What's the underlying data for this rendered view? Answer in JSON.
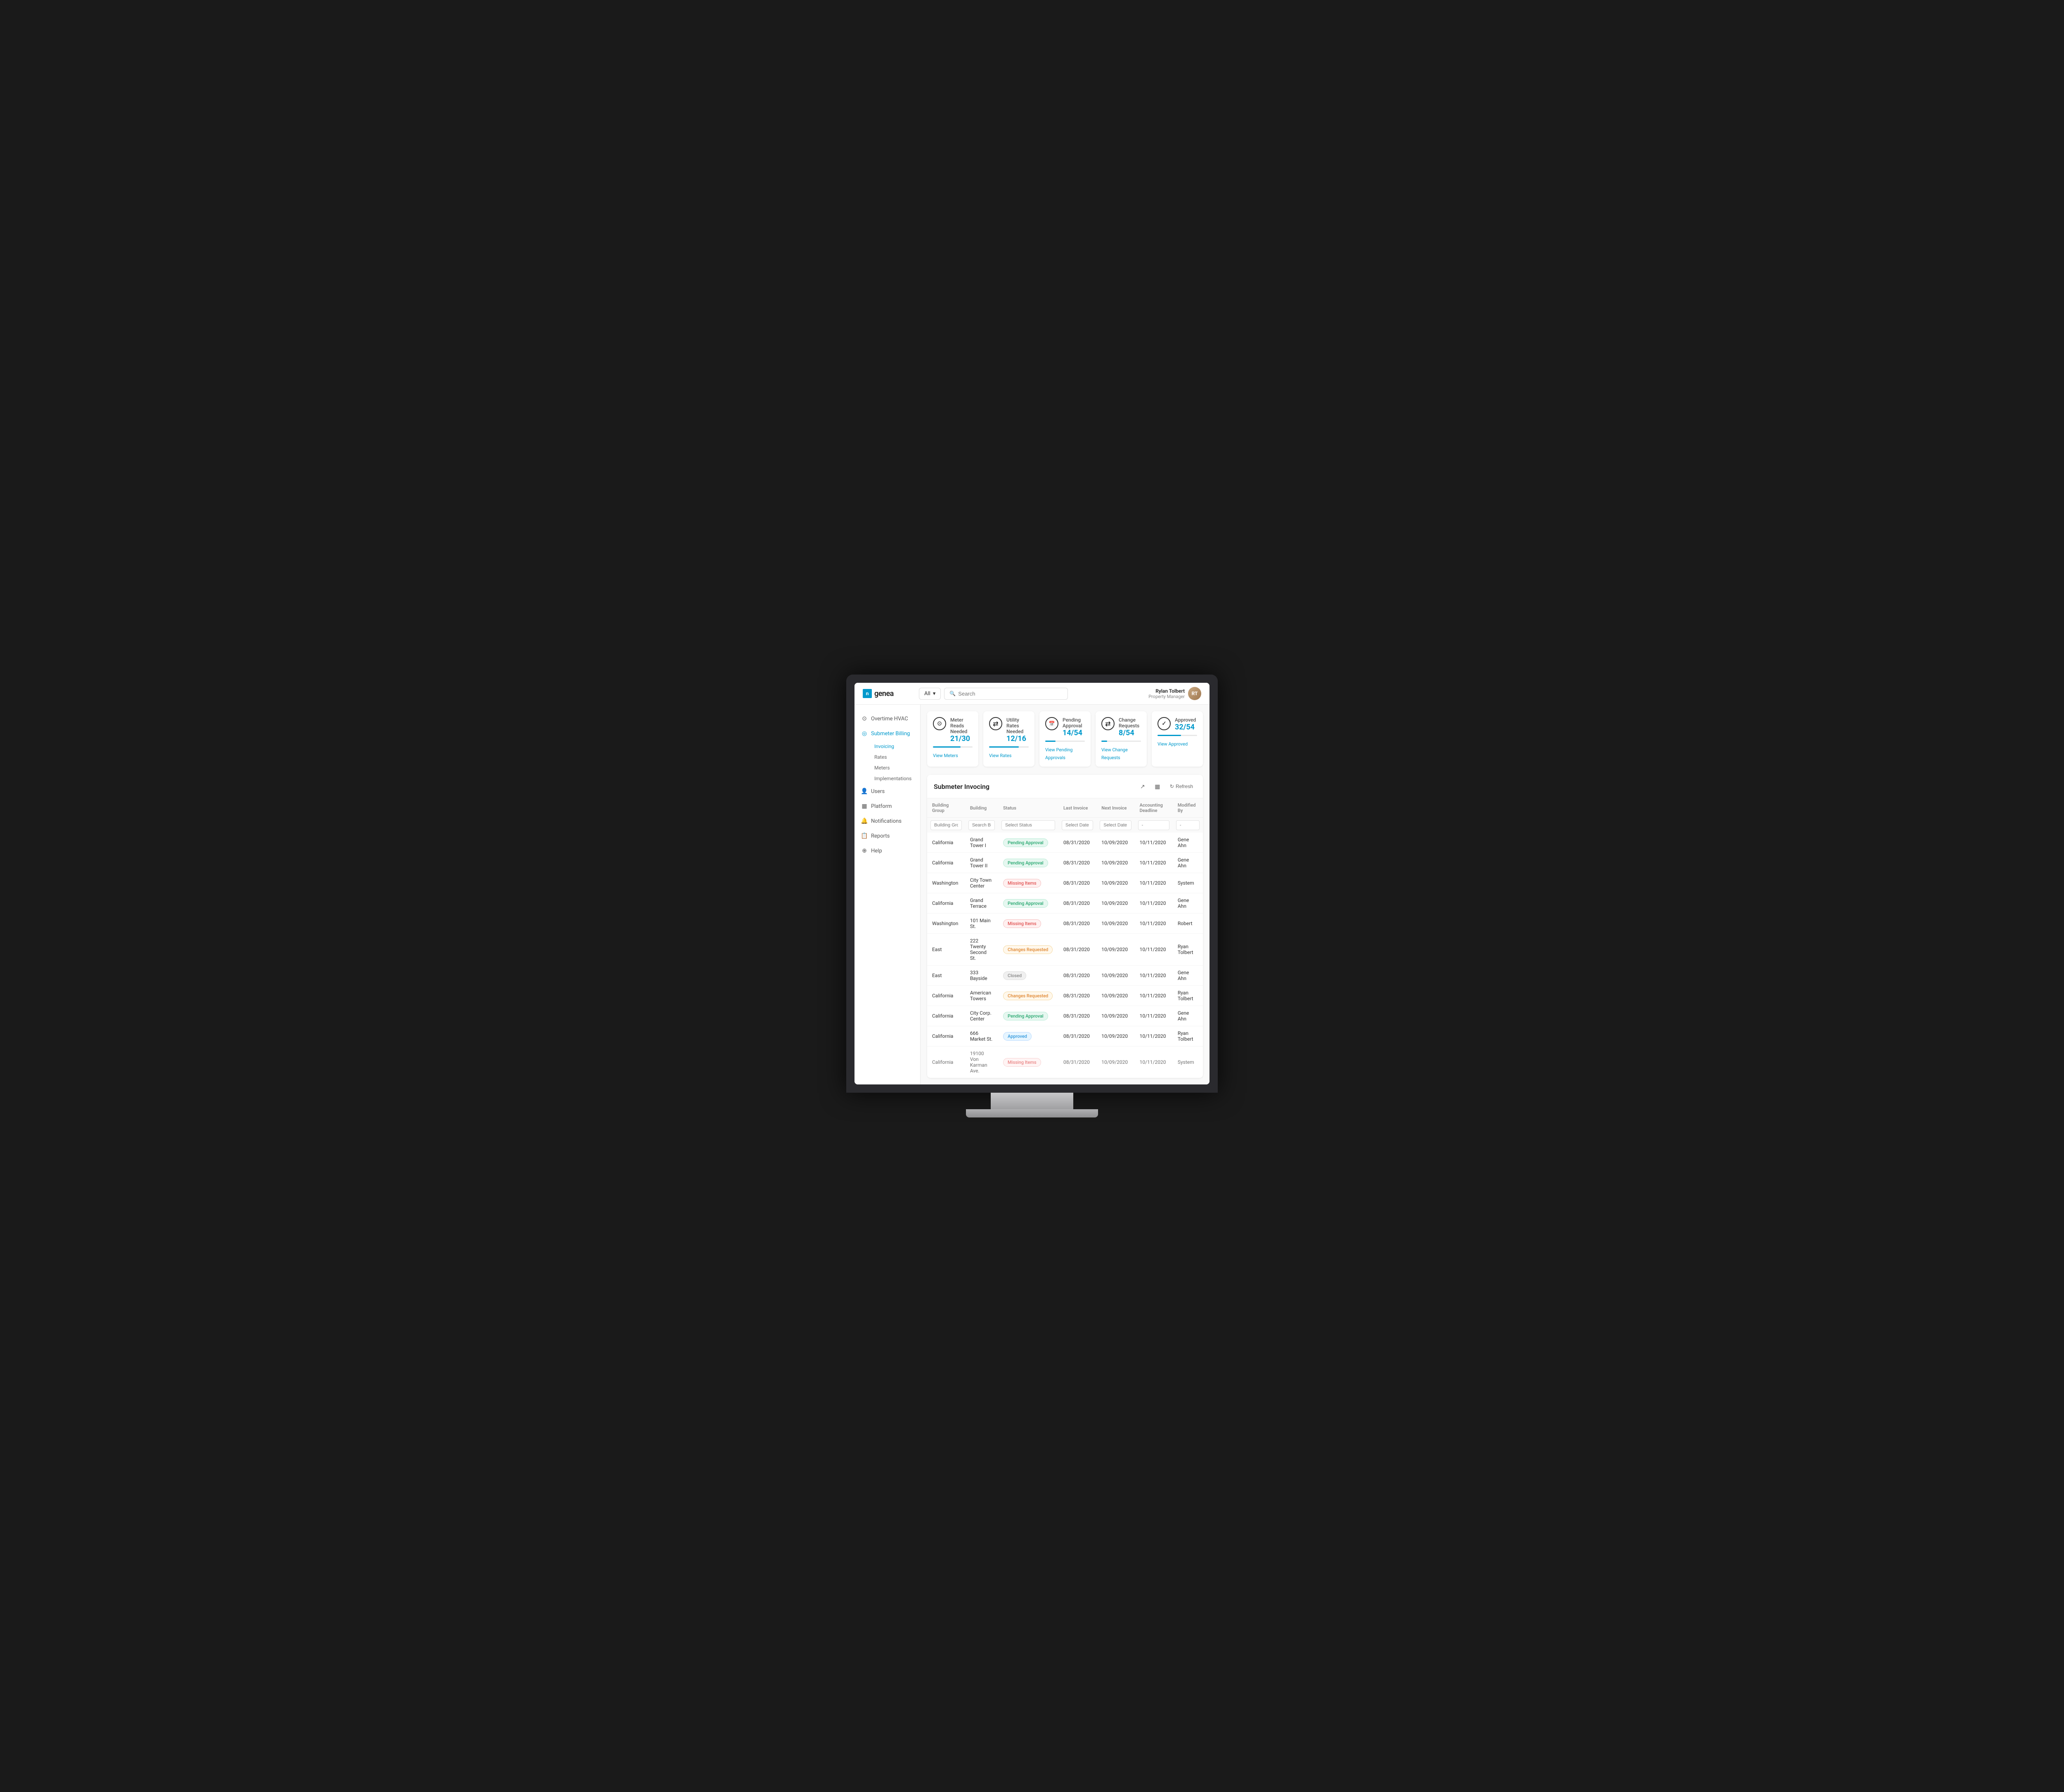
{
  "app": {
    "logo_text": "genea",
    "logo_icon": "n"
  },
  "topbar": {
    "filter_label": "All",
    "search_placeholder": "Search",
    "user": {
      "name": "Rylan Tolbert",
      "role": "Property Manager",
      "initials": "RT"
    }
  },
  "sidebar": {
    "items": [
      {
        "id": "overtime-hvac",
        "label": "Overtime HVAC",
        "icon": "⊙"
      },
      {
        "id": "submeter-billing",
        "label": "Submeter Billing",
        "icon": "◎",
        "active": true
      },
      {
        "id": "users",
        "label": "Users",
        "icon": "👤"
      },
      {
        "id": "platform",
        "label": "Platform",
        "icon": "▦"
      },
      {
        "id": "notifications",
        "label": "Notifications",
        "icon": "🔔"
      },
      {
        "id": "reports",
        "label": "Reports",
        "icon": "📋"
      },
      {
        "id": "help",
        "label": "Help",
        "icon": "⊕"
      }
    ],
    "submenu": [
      {
        "id": "invoicing",
        "label": "Invoicing",
        "active": true
      },
      {
        "id": "rates",
        "label": "Rates"
      },
      {
        "id": "meters",
        "label": "Meters"
      },
      {
        "id": "implementations",
        "label": "Implementations"
      }
    ]
  },
  "stats": [
    {
      "id": "meter-reads",
      "title": "Meter Reads Needed",
      "value": "21/30",
      "progress": 70,
      "link": "View Meters",
      "icon": "⊙"
    },
    {
      "id": "utility-rates",
      "title": "Utility Rates Needed",
      "value": "12/16",
      "progress": 75,
      "link": "View Rates",
      "icon": "⇄"
    },
    {
      "id": "pending-approval",
      "title": "Pending Approval",
      "value": "14/54",
      "progress": 26,
      "link": "View Pending Approvals",
      "icon": "📅"
    },
    {
      "id": "change-requests",
      "title": "Change Requests",
      "value": "8/54",
      "progress": 15,
      "link": "View Change Requests",
      "icon": "⇄"
    },
    {
      "id": "approved",
      "title": "Approved",
      "value": "32/54",
      "progress": 59,
      "link": "View Approved",
      "icon": "✓"
    }
  ],
  "table": {
    "title": "Submeter Invocing",
    "refresh_label": "Refresh",
    "columns": [
      "Building Group",
      "Building",
      "Status",
      "Last Invoice",
      "Next Invoice",
      "Accounting Deadline",
      "Modified By"
    ],
    "filters": [
      {
        "placeholder": "Building Group"
      },
      {
        "placeholder": "Search Building"
      },
      {
        "placeholder": "Select Status"
      },
      {
        "placeholder": "Select Date"
      },
      {
        "placeholder": "Select Date"
      },
      {
        "placeholder": "-"
      },
      {
        "placeholder": "-"
      }
    ],
    "rows": [
      {
        "building_group": "California",
        "building": "Grand Tower I",
        "status": "Pending Approval",
        "status_type": "pending",
        "last_invoice": "08/31/2020",
        "next_invoice": "10/09/2020",
        "accounting_deadline": "10/11/2020",
        "modified_by": "Gene Ahn"
      },
      {
        "building_group": "California",
        "building": "Grand Tower II",
        "status": "Pending Approval",
        "status_type": "pending",
        "last_invoice": "08/31/2020",
        "next_invoice": "10/09/2020",
        "accounting_deadline": "10/11/2020",
        "modified_by": "Gene Ahn"
      },
      {
        "building_group": "Washington",
        "building": "City Town Center",
        "status": "Missing Items",
        "status_type": "missing",
        "last_invoice": "08/31/2020",
        "next_invoice": "10/09/2020",
        "accounting_deadline": "10/11/2020",
        "modified_by": "System"
      },
      {
        "building_group": "California",
        "building": "Grand Terrace",
        "status": "Pending Approval",
        "status_type": "pending",
        "last_invoice": "08/31/2020",
        "next_invoice": "10/09/2020",
        "accounting_deadline": "10/11/2020",
        "modified_by": "Gene Ahn"
      },
      {
        "building_group": "Washington",
        "building": "101 Main St.",
        "status": "Missing Items",
        "status_type": "missing",
        "last_invoice": "08/31/2020",
        "next_invoice": "10/09/2020",
        "accounting_deadline": "10/11/2020",
        "modified_by": "Robert"
      },
      {
        "building_group": "East",
        "building": "222 Twenty Second St.",
        "status": "Changes Requested",
        "status_type": "changes",
        "last_invoice": "08/31/2020",
        "next_invoice": "10/09/2020",
        "accounting_deadline": "10/11/2020",
        "modified_by": "Ryan Tolbert"
      },
      {
        "building_group": "East",
        "building": "333 Bayside",
        "status": "Closed",
        "status_type": "closed",
        "last_invoice": "08/31/2020",
        "next_invoice": "10/09/2020",
        "accounting_deadline": "10/11/2020",
        "modified_by": "Gene Ahn"
      },
      {
        "building_group": "California",
        "building": "American Towers",
        "status": "Changes Requested",
        "status_type": "changes",
        "last_invoice": "08/31/2020",
        "next_invoice": "10/09/2020",
        "accounting_deadline": "10/11/2020",
        "modified_by": "Ryan Tolbert"
      },
      {
        "building_group": "California",
        "building": "City Corp. Center",
        "status": "Pending Approval",
        "status_type": "pending",
        "last_invoice": "08/31/2020",
        "next_invoice": "10/09/2020",
        "accounting_deadline": "10/11/2020",
        "modified_by": "Gene Ahn"
      },
      {
        "building_group": "California",
        "building": "666 Market St.",
        "status": "Approved",
        "status_type": "approved",
        "last_invoice": "08/31/2020",
        "next_invoice": "10/09/2020",
        "accounting_deadline": "10/11/2020",
        "modified_by": "Ryan Tolbert"
      },
      {
        "building_group": "California",
        "building": "19100 Von Karman Ave.",
        "status": "Missing Items",
        "status_type": "missing",
        "last_invoice": "08/31/2020",
        "next_invoice": "10/09/2020",
        "accounting_deadline": "10/11/2020",
        "modified_by": "System"
      }
    ]
  }
}
